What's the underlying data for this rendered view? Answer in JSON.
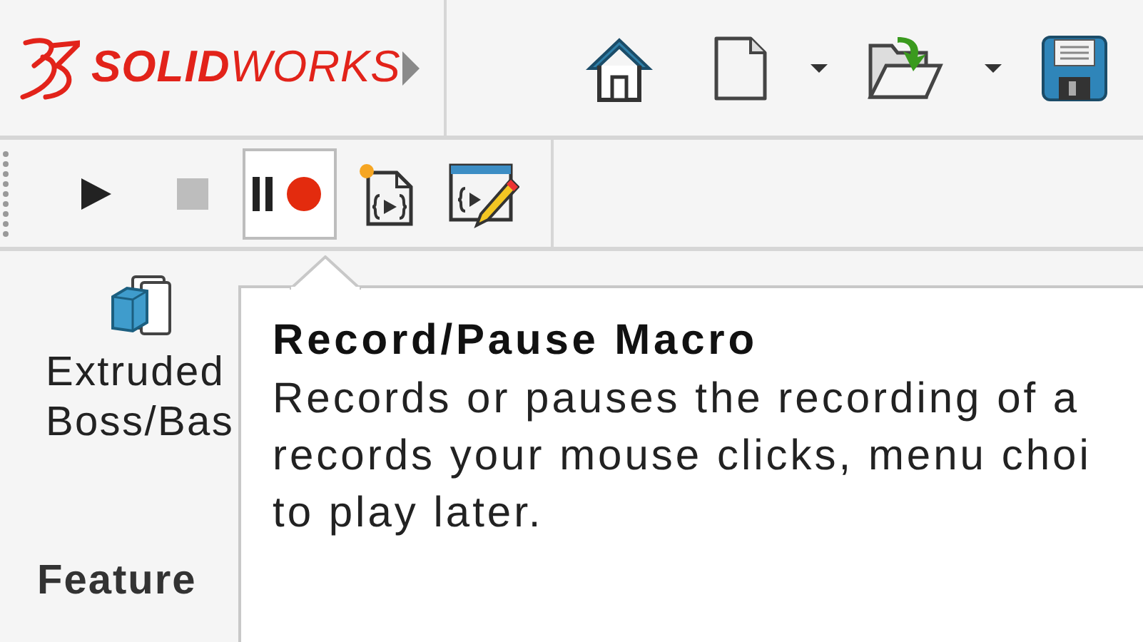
{
  "logo": {
    "text": "**SOLID**WORKS"
  },
  "quick_access": [
    {
      "kind": "home"
    },
    {
      "kind": "new",
      "dropdown": true
    },
    {
      "kind": "open",
      "dropdown": true
    },
    {
      "kind": "save",
      "dropdown": false
    }
  ],
  "macro_toolbar": [
    {
      "kind": "play",
      "disabled": false,
      "selected": false
    },
    {
      "kind": "stop",
      "disabled": true,
      "selected": false
    },
    {
      "kind": "record_pause",
      "disabled": false,
      "selected": true
    },
    {
      "kind": "new_macro",
      "disabled": false,
      "selected": false
    },
    {
      "kind": "edit_macro",
      "disabled": false,
      "selected": false
    }
  ],
  "ribbon": {
    "command": {
      "label_lines": [
        "Extruded",
        "Boss/Bas"
      ]
    },
    "tab": "Feature"
  },
  "tooltip": {
    "title": "Record/Pause Macro",
    "lines": [
      "Records or pauses the recording of a",
      "records your mouse clicks, menu choi",
      "to play later."
    ]
  }
}
